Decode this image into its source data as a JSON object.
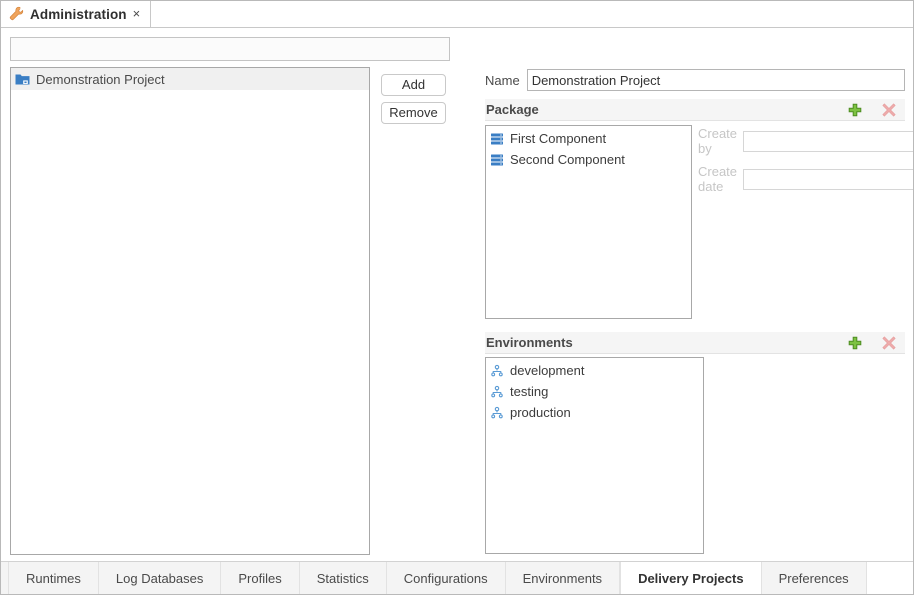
{
  "window": {
    "tab": {
      "title": "Administration",
      "icon": "wrench-icon",
      "close_label": "×"
    }
  },
  "left_panel": {
    "filter": {
      "value": "",
      "placeholder": ""
    },
    "projects": [
      {
        "label": "Demonstration Project",
        "icon": "folder-icon",
        "selected": true
      }
    ],
    "buttons": {
      "add_label": "Add",
      "remove_label": "Remove"
    }
  },
  "details": {
    "name": {
      "label": "Name",
      "value": "Demonstration Project"
    },
    "package": {
      "header": "Package",
      "add_icon": "plus-icon",
      "remove_icon": "delete-icon",
      "items": [
        {
          "label": "First Component",
          "icon": "component-icon"
        },
        {
          "label": "Second Component",
          "icon": "component-icon"
        }
      ],
      "meta": [
        {
          "label": "Create by",
          "value": ""
        },
        {
          "label": "Create date",
          "value": ""
        }
      ]
    },
    "environments": {
      "header": "Environments",
      "add_icon": "plus-icon",
      "remove_icon": "delete-icon",
      "items": [
        {
          "label": "development",
          "icon": "hierarchy-icon"
        },
        {
          "label": "testing",
          "icon": "hierarchy-icon"
        },
        {
          "label": "production",
          "icon": "hierarchy-icon"
        }
      ]
    }
  },
  "bottom_tabs": {
    "items": [
      {
        "label": "Runtimes",
        "active": false
      },
      {
        "label": "Log Databases",
        "active": false
      },
      {
        "label": "Profiles",
        "active": false
      },
      {
        "label": "Statistics",
        "active": false
      },
      {
        "label": "Configurations",
        "active": false
      },
      {
        "label": "Environments",
        "active": false
      },
      {
        "label": "Delivery Projects",
        "active": true
      },
      {
        "label": "Preferences",
        "active": false
      }
    ]
  },
  "colors": {
    "accent_blue": "#3a7ec4",
    "add_green": "#6eb43f",
    "delete_red": "#e8a8a8",
    "selection_gray": "#f0f0f0"
  }
}
